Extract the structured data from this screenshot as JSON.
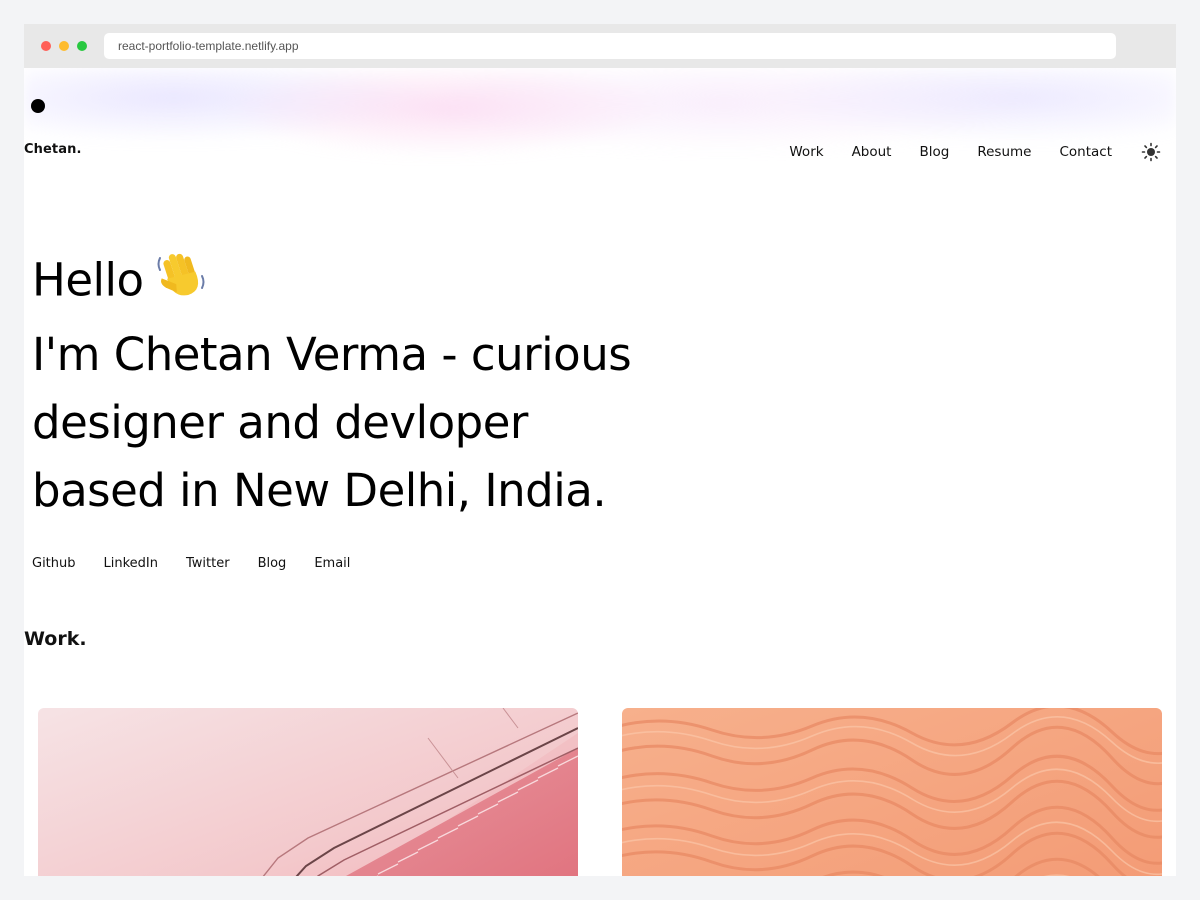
{
  "browser": {
    "url": "react-portfolio-template.netlify.app"
  },
  "header": {
    "logo": "Chetan.",
    "nav": [
      "Work",
      "About",
      "Blog",
      "Resume",
      "Contact"
    ],
    "theme_icon": "sun-icon"
  },
  "hero": {
    "line1": "Hello",
    "emoji_icon": "waving-hand-icon",
    "line2": "I'm Chetan Verma - curious",
    "line3": "designer and devloper",
    "line4": "based in New Delhi, India."
  },
  "social": [
    "Github",
    "LinkedIn",
    "Twitter",
    "Blog",
    "Email"
  ],
  "work": {
    "title": "Work.",
    "projects": [
      {
        "image_icon": "escalator-photo",
        "accent": "#f4a7ad"
      },
      {
        "image_icon": "sand-dunes-photo",
        "accent": "#f6a57c"
      }
    ]
  }
}
